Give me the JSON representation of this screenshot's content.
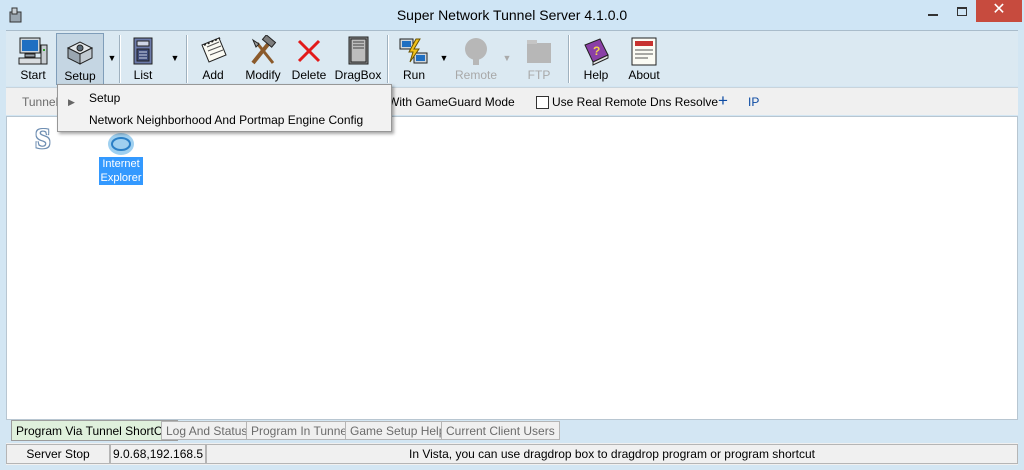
{
  "window": {
    "title": "Super Network Tunnel Server 4.1.0.0",
    "app_icon": "gear-box-icon",
    "controls": [
      "minimize-icon",
      "maximize-icon",
      "close-icon"
    ]
  },
  "toolbar": {
    "start": {
      "label": "Start",
      "icon": "computer-icon"
    },
    "setup": {
      "label": "Setup",
      "icon": "gear-box-icon"
    },
    "list": {
      "label": "List",
      "icon": "list-box-icon"
    },
    "add": {
      "label": "Add",
      "icon": "notepad-icon"
    },
    "modify": {
      "label": "Modify",
      "icon": "tools-icon"
    },
    "delete": {
      "label": "Delete",
      "icon": "red-x-icon"
    },
    "dragbox": {
      "label": "DragBox",
      "icon": "book-icon"
    },
    "run": {
      "label": "Run",
      "icon": "run-icon"
    },
    "remote": {
      "label": "Remote",
      "icon": "remote-icon",
      "disabled": true
    },
    "ftp": {
      "label": "FTP",
      "icon": "ftp-icon",
      "disabled": true
    },
    "help": {
      "label": "Help",
      "icon": "help-book-icon"
    },
    "about": {
      "label": "About",
      "icon": "about-icon"
    }
  },
  "options": {
    "tunnel_label": "Tunnel",
    "gameguard_label": "With GameGuard Mode",
    "dns_label": "Use Real Remote Dns Resolve",
    "dns_checked": false,
    "plus_label": "+",
    "ip_label": "IP"
  },
  "setup_menu": {
    "items": [
      {
        "label": "Setup",
        "hotkey": "S"
      },
      {
        "label": "Network Neighborhood And Portmap Engine Config",
        "hotkey": "N"
      }
    ]
  },
  "canvas": {
    "logo_text": "S",
    "shortcuts": [
      {
        "name_line1": "Internet",
        "name_line2": "Explorer",
        "icon": "internet-explorer-icon"
      }
    ]
  },
  "tabs": [
    {
      "label": "Program Via Tunnel ShortCut",
      "active": true
    },
    {
      "label": "Log And Status",
      "active": false
    },
    {
      "label": "Program In Tunnel",
      "active": false
    },
    {
      "label": "Game Setup Help",
      "active": false
    },
    {
      "label": "Current Client Users",
      "active": false
    }
  ],
  "status": {
    "state": "Server Stop",
    "ip": "9.0.68,192.168.5",
    "message": "In Vista, you can use dragdrop box to dragdrop program or program shortcut"
  },
  "colors": {
    "titlebar": "#cfe5f5",
    "close_button": "#c74b3e",
    "selection": "#3399ff",
    "active_tab": "#dff0dc"
  }
}
